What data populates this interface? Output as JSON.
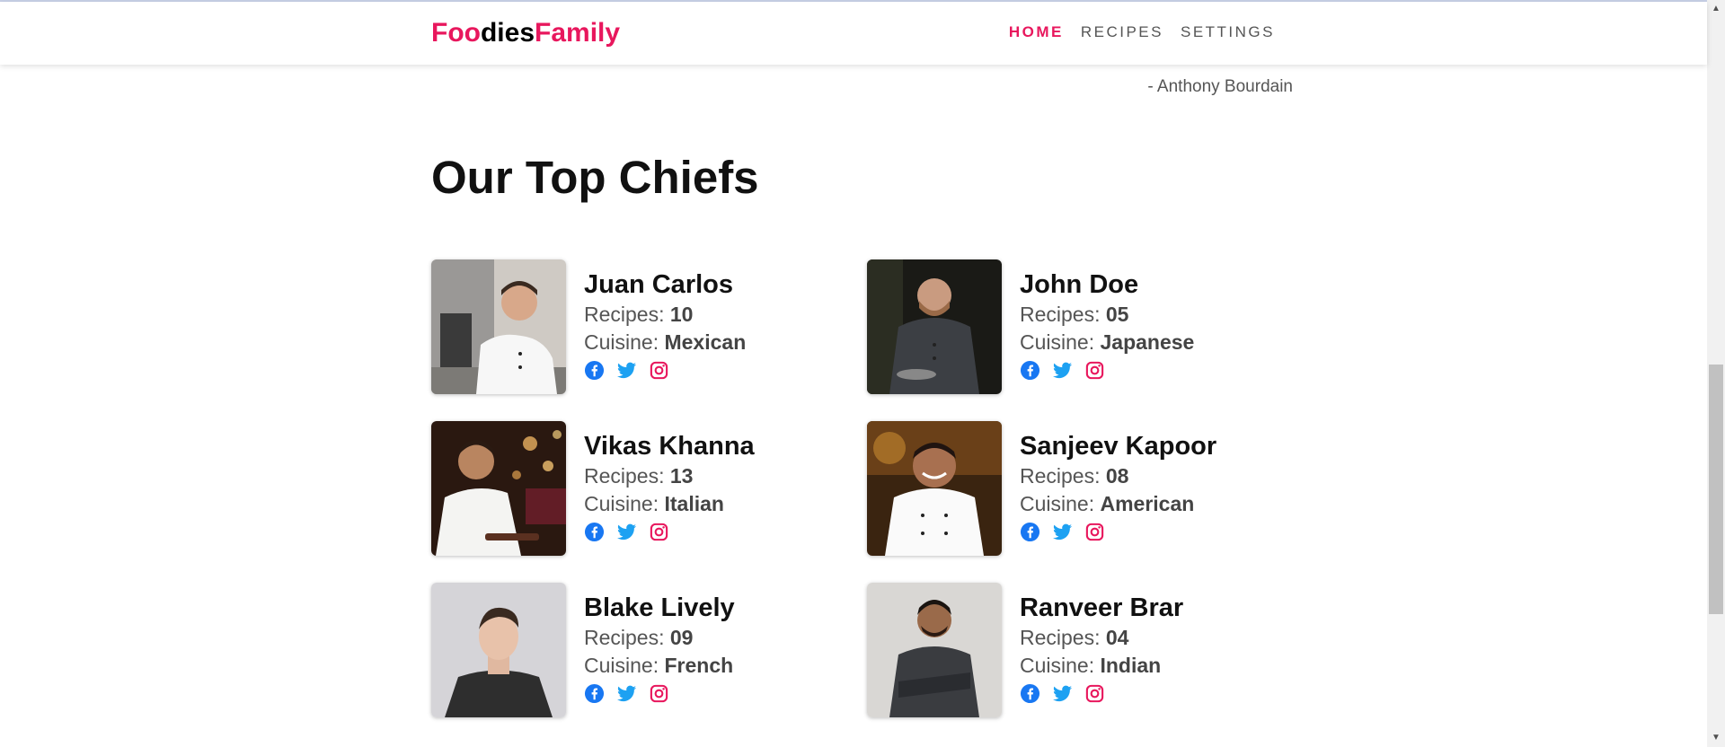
{
  "brand": {
    "part1": "Foo",
    "part2": "dies",
    "part3": "Family"
  },
  "nav": {
    "home": "HOME",
    "recipes": "RECIPES",
    "settings": "SETTINGS"
  },
  "quote": {
    "author": "- Anthony Bourdain"
  },
  "section": {
    "title": "Our Top Chiefs"
  },
  "labels": {
    "recipes": "Recipes: ",
    "cuisine": "Cuisine: "
  },
  "chefs": [
    {
      "name": "Juan Carlos",
      "recipes": "10",
      "cuisine": "Mexican"
    },
    {
      "name": "John Doe",
      "recipes": "05",
      "cuisine": "Japanese"
    },
    {
      "name": "Vikas Khanna",
      "recipes": "13",
      "cuisine": "Italian"
    },
    {
      "name": "Sanjeev Kapoor",
      "recipes": "08",
      "cuisine": "American"
    },
    {
      "name": "Blake Lively",
      "recipes": "09",
      "cuisine": "French"
    },
    {
      "name": "Ranveer Brar",
      "recipes": "04",
      "cuisine": "Indian"
    }
  ],
  "colors": {
    "accent": "#e8175d",
    "facebook": "#1877f2",
    "twitter": "#1da1f2",
    "instagram": "#e8175d"
  },
  "icons": [
    "facebook-icon",
    "twitter-icon",
    "instagram-icon"
  ]
}
